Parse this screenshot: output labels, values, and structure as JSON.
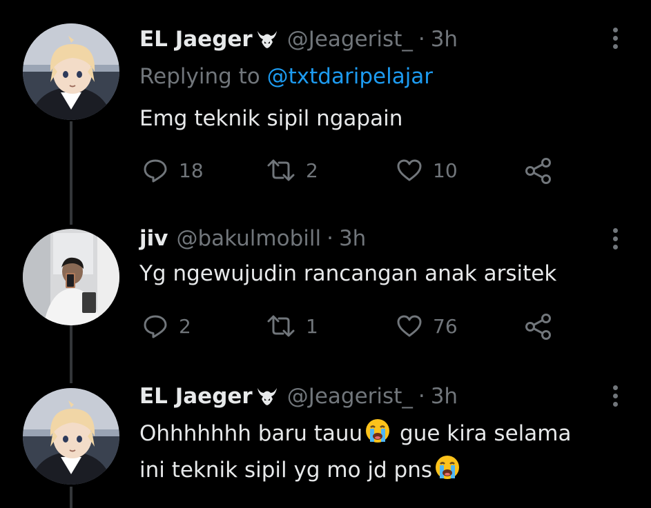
{
  "colors": {
    "background": "#000000",
    "text": "#e7e9ea",
    "muted": "#71767b",
    "link": "#1d9bf0",
    "thread_line": "#333639"
  },
  "tweets": [
    {
      "display_name": "EL Jaeger",
      "badge_icon": "horned-helmet-icon",
      "handle": "@Jeagerist_",
      "separator": "·",
      "time": "3h",
      "replying_to_label": "Replying to",
      "replying_to_handle": "@txtdaripelajar",
      "text_line1": "Emg teknik sipil ngapain",
      "reply_count": "18",
      "retweet_count": "2",
      "like_count": "10"
    },
    {
      "display_name": "jiv",
      "handle": "@bakulmobill",
      "separator": "·",
      "time": "3h",
      "text_line1": "Yg ngewujudin rancangan anak arsitek",
      "reply_count": "2",
      "retweet_count": "1",
      "like_count": "76"
    },
    {
      "display_name": "EL Jaeger",
      "badge_icon": "horned-helmet-icon",
      "handle": "@Jeagerist_",
      "separator": "·",
      "time": "3h",
      "text_part1": "Ohhhhhhh baru tauu",
      "text_part2": " gue kira selama",
      "text_part3": "ini teknik sipil yg mo jd pns",
      "emoji_icon": "loudly-crying-face-icon"
    }
  ]
}
